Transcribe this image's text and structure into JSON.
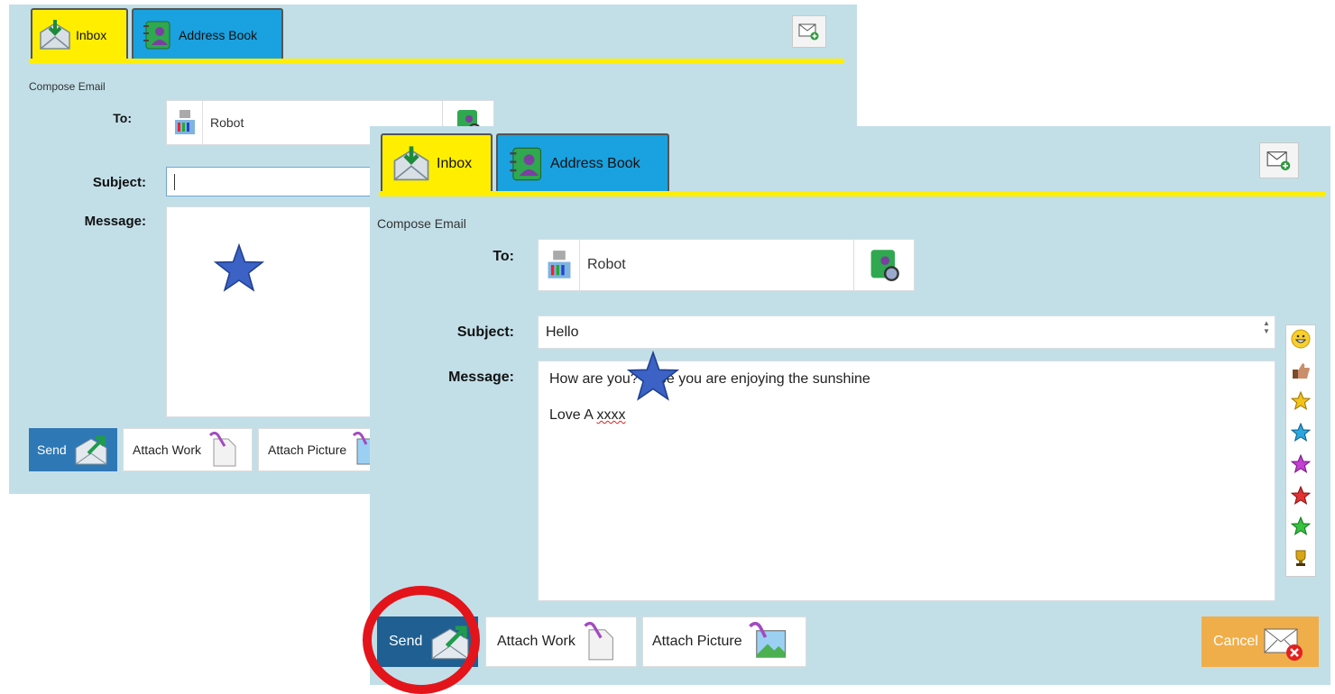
{
  "back": {
    "tabs": {
      "inbox": "Inbox",
      "address_book": "Address Book"
    },
    "title": "Compose Email",
    "to_label": "To:",
    "to_value": "Robot",
    "subject_label": "Subject:",
    "subject_value": "",
    "message_label": "Message:",
    "buttons": {
      "send": "Send",
      "attach_work": "Attach Work",
      "attach_picture": "Attach Picture"
    }
  },
  "front": {
    "tabs": {
      "inbox": "Inbox",
      "address_book": "Address Book"
    },
    "title": "Compose Email",
    "to_label": "To:",
    "to_value": "Robot",
    "subject_label": "Subject:",
    "subject_value": "Hello",
    "message_label": "Message:",
    "message_line1": "How are you?  hope you are enjoying the sunshine",
    "message_line2_prefix": "Love A ",
    "message_line2_word": "xxxx",
    "buttons": {
      "send": "Send",
      "attach_work": "Attach Work",
      "attach_picture": "Attach Picture",
      "cancel": "Cancel"
    },
    "emojis": [
      "grin-icon",
      "thumbs-up-icon",
      "gold-star-icon",
      "blue-star-icon",
      "purple-star-icon",
      "red-star-icon",
      "green-star-icon",
      "trophy-icon"
    ]
  },
  "colors": {
    "panel_bg": "#c2dfe8",
    "tab_inbox": "#ffee00",
    "tab_address": "#1aa1df",
    "send": "#2f78b6",
    "cancel": "#f0ae4a",
    "annotation_circle": "#e4141b",
    "star_marker": "#3b62c4"
  }
}
